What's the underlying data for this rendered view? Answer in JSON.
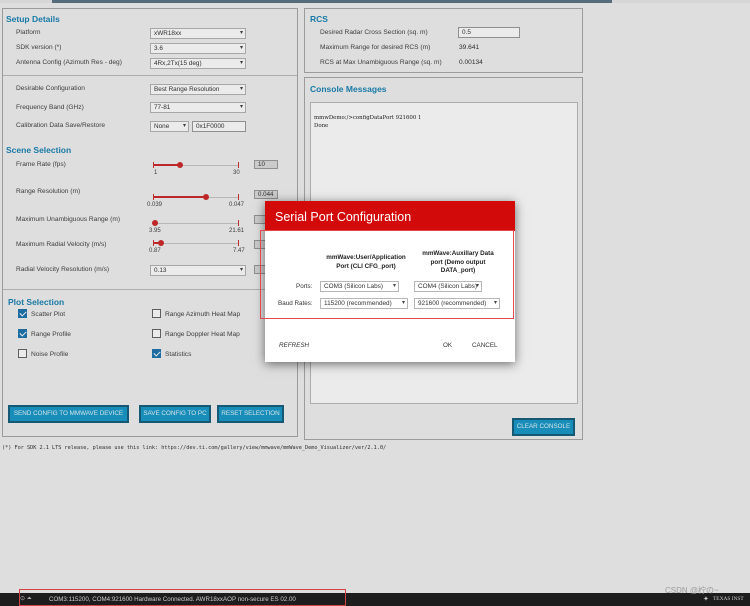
{
  "setup": {
    "title": "Setup Details",
    "rows": [
      {
        "label": "Platform",
        "value": "xWR18xx"
      },
      {
        "label": "SDK version (*)",
        "value": "3.6"
      },
      {
        "label": "Antenna Config (Azimuth Res - deg)",
        "value": "4Rx,2Tx(15 deg)"
      }
    ]
  },
  "config": {
    "desirable_label": "Desirable Configuration",
    "desirable_value": "Best Range Resolution",
    "freq_label": "Frequency Band (GHz)",
    "freq_value": "77-81",
    "calib_label": "Calibration Data Save/Restore",
    "calib_value": "None",
    "calib_addr": "0x1F0000"
  },
  "scene": {
    "title": "Scene Selection",
    "sliders": [
      {
        "label": "Frame Rate (fps)",
        "min": "1",
        "max": "30",
        "value": "10",
        "level": 0.32
      },
      {
        "label": "Range Resolution (m)",
        "min": "0.039",
        "max": "0.047",
        "value": "0.044",
        "level": 0.62
      },
      {
        "label": "Maximum Unambiguous Range (m)",
        "min": "3.95",
        "max": "21.61",
        "value": "",
        "level": 0.0
      },
      {
        "label": "Maximum Radial Velocity (m/s)",
        "min": "0.87",
        "max": "7.47",
        "value": "",
        "level": 0.08
      }
    ],
    "velres_label": "Radial Velocity Resolution (m/s)",
    "velres_value": "0.13"
  },
  "plot": {
    "title": "Plot Selection",
    "items": [
      {
        "label": "Scatter Plot",
        "checked": true
      },
      {
        "label": "Range Azimuth Heat Map",
        "checked": false
      },
      {
        "label": "Range Profile",
        "checked": true
      },
      {
        "label": "Range Doppler Heat Map",
        "checked": false
      },
      {
        "label": "Noise Profile",
        "checked": false
      },
      {
        "label": "Statistics",
        "checked": true
      }
    ]
  },
  "buttons": {
    "send": "SEND CONFIG TO MMWAVE DEVICE",
    "save": "SAVE CONFIG TO PC",
    "reset": "RESET SELECTION",
    "clear": "CLEAR CONSOLE"
  },
  "rcs": {
    "title": "RCS",
    "desired_label": "Desired Radar Cross Section (sq. m)",
    "desired_value": "0.5",
    "maxrange_label": "Maximum Range for desired RCS (m)",
    "maxrange_value": "39.641",
    "rcsmax_label": "RCS at Max Unambiguous Range (sq. m)",
    "rcsmax_value": "0.00134"
  },
  "console": {
    "title": "Console Messages",
    "lines": [
      "mmwDemo:/>configDataPort 921600 1",
      "Done"
    ]
  },
  "footnote": "(*) For SDK 2.1 LTS release, please use this link: https://dev.ti.com/gallery/view/mmwave/mmWave_Demo_Visualizer/ver/2.1.0/",
  "dialog": {
    "title": "Serial Port Configuration",
    "col1": [
      "mmWave:User/Application",
      "Port (CLI CFG_port)"
    ],
    "col2": [
      "mmWave:Auxillary Data",
      "port (Demo output",
      "DATA_port)"
    ],
    "ports_label": "Ports:",
    "baud_label": "Baud Rates:",
    "port1": "COM3 (Silicon Labs)",
    "port2": "COM4 (Silicon Labs)",
    "baud1": "115200 (recommended)",
    "baud2": "921600 (recommended)",
    "refresh": "REFRESH",
    "ok": "OK",
    "cancel": "CANCEL"
  },
  "status": {
    "text": "COM3:115200, COM4:921600    Hardware Connected.  AWR18xxAOP non-secure ES 02.00",
    "brand": "TEXAS INST",
    "watermark": "CSDN @柠の~"
  },
  "colors": {
    "accent": "#1b84b5",
    "button": "#1b9ac9",
    "dialog_header": "#d30a0a",
    "highlight": "#e44949"
  }
}
